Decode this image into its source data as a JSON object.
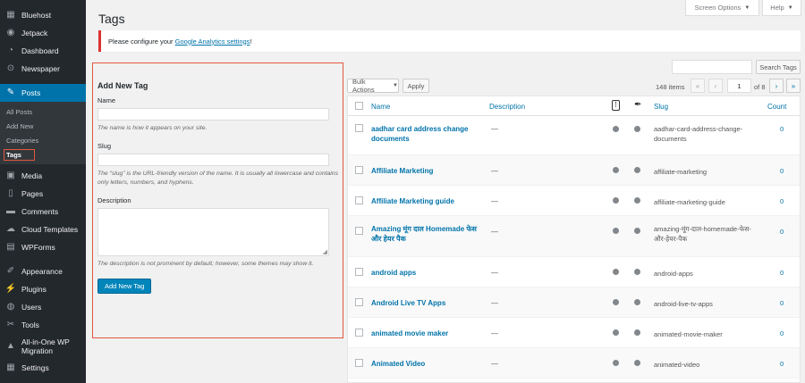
{
  "sidebar": {
    "top_items": [
      {
        "label": "Bluehost",
        "icon": "bluehost-icon",
        "glyph": "▦"
      },
      {
        "label": "Jetpack",
        "icon": "jetpack-icon",
        "glyph": "◉"
      },
      {
        "label": "Dashboard",
        "icon": "dashboard-icon",
        "glyph": "◔"
      },
      {
        "label": "Newspaper",
        "icon": "newspaper-icon",
        "glyph": "⊙"
      }
    ],
    "posts": {
      "label": "Posts",
      "icon": "pin-icon",
      "glyph": "✎"
    },
    "post_sub": [
      "All Posts",
      "Add New",
      "Categories",
      "Tags"
    ],
    "bottom_items": [
      {
        "label": "Media",
        "icon": "media-icon",
        "glyph": "▣"
      },
      {
        "label": "Pages",
        "icon": "pages-icon",
        "glyph": "▯"
      },
      {
        "label": "Comments",
        "icon": "comments-icon",
        "glyph": "▬"
      },
      {
        "label": "Cloud Templates",
        "icon": "cloud-icon",
        "glyph": "☁"
      },
      {
        "label": "WPForms",
        "icon": "wpforms-icon",
        "glyph": "▤"
      }
    ],
    "lower_items": [
      {
        "label": "Appearance",
        "icon": "brush-icon",
        "glyph": "✐"
      },
      {
        "label": "Plugins",
        "icon": "plugin-icon",
        "glyph": "⚡"
      },
      {
        "label": "Users",
        "icon": "users-icon",
        "glyph": "◍"
      },
      {
        "label": "Tools",
        "icon": "tools-icon",
        "glyph": "✂"
      }
    ],
    "migration": {
      "label": "All-in-One WP Migration",
      "icon": "migration-icon",
      "glyph": "▲"
    },
    "settings": {
      "label": "Settings",
      "icon": "settings-icon",
      "glyph": "▦"
    }
  },
  "header": {
    "title": "Tags",
    "screen_options": "Screen Options",
    "help": "Help"
  },
  "notice": {
    "prefix": "Please configure your ",
    "link": "Google Analytics settings",
    "suffix": "!"
  },
  "add_form": {
    "heading": "Add New Tag",
    "name_label": "Name",
    "name_help": "The name is how it appears on your site.",
    "slug_label": "Slug",
    "slug_help": "The “slug” is the URL-friendly version of the name. It is usually all lowercase and contains only letters, numbers, and hyphens.",
    "desc_label": "Description",
    "desc_help": "The description is not prominent by default; however, some themes may show it.",
    "submit": "Add New Tag"
  },
  "list_controls": {
    "search_button": "Search Tags",
    "bulk_actions": "Bulk Actions",
    "apply": "Apply",
    "items_count": "148 items",
    "first": "«",
    "prev": "‹",
    "current_page": "1",
    "of_pages": "of 8",
    "next": "›",
    "last": "»"
  },
  "table": {
    "columns": {
      "name": "Name",
      "description": "Description",
      "slug": "Slug",
      "count": "Count"
    },
    "rows": [
      {
        "name": "aadhar card address change documents",
        "desc": "—",
        "slug": "aadhar-card-address-change-documents",
        "count": "0"
      },
      {
        "name": "Affiliate Marketing",
        "desc": "—",
        "slug": "affiliate-marketing",
        "count": "0"
      },
      {
        "name": "Affiliate Marketing guide",
        "desc": "—",
        "slug": "affiliate-marketing-guide",
        "count": "0"
      },
      {
        "name": "Amazing मूंग दाल Homemade फेस और हेयर पैक",
        "desc": "—",
        "slug": "amazing-मूंग-दाल-homemade-फेस-और-हेयर-पैक",
        "count": "0"
      },
      {
        "name": "android apps",
        "desc": "—",
        "slug": "android-apps",
        "count": "0"
      },
      {
        "name": "Android Live TV Apps",
        "desc": "—",
        "slug": "android-live-tv-apps",
        "count": "0"
      },
      {
        "name": "animated movie maker",
        "desc": "—",
        "slug": "animated-movie-maker",
        "count": "0"
      },
      {
        "name": "Animated Video",
        "desc": "—",
        "slug": "animated-video",
        "count": "0"
      }
    ]
  }
}
